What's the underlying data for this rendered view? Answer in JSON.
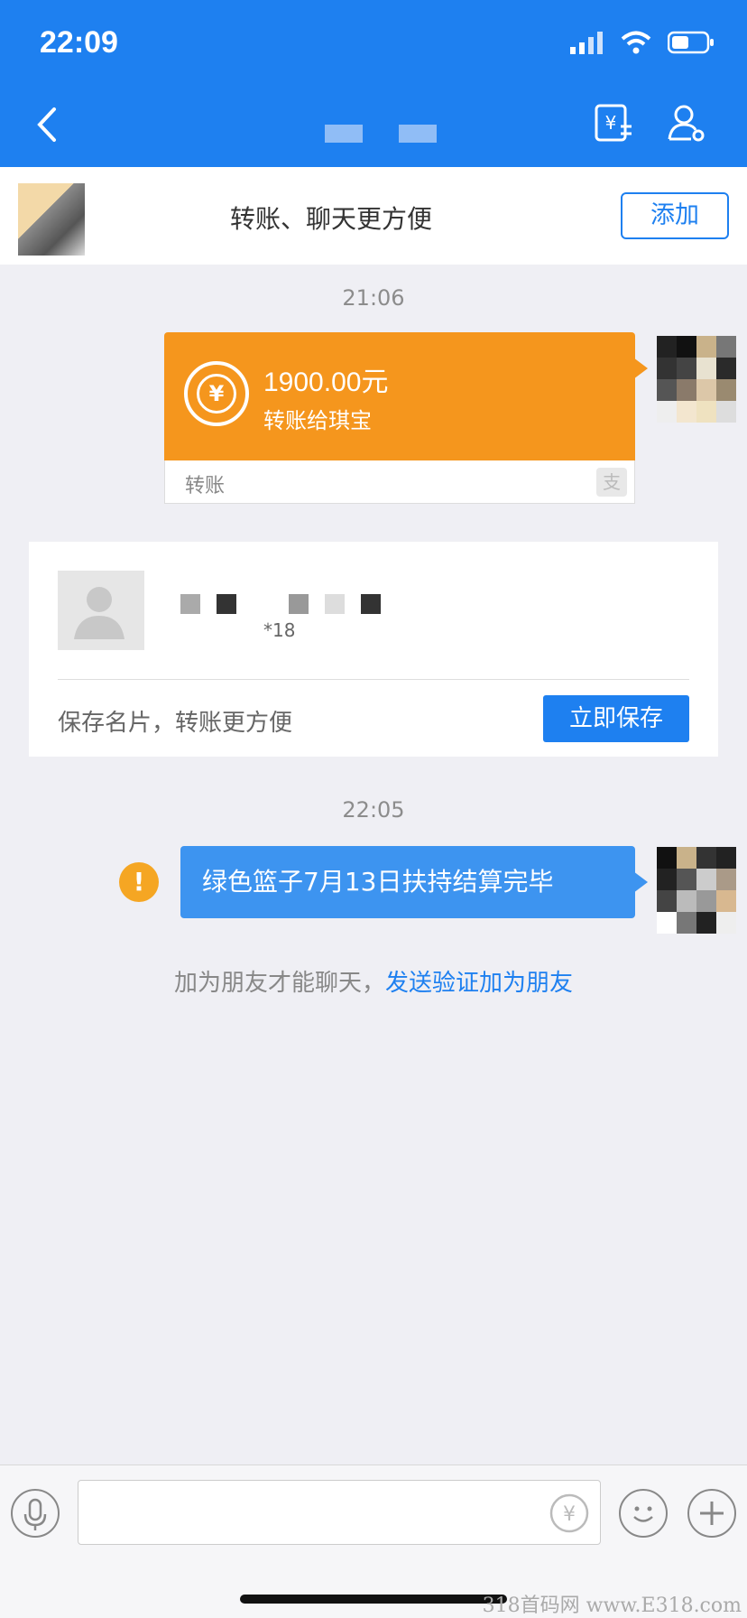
{
  "status_bar": {
    "time": "22:09"
  },
  "banner": {
    "text": "转账、聊天更方便",
    "add_label": "添加"
  },
  "chat": {
    "time1": "21:06",
    "transfer": {
      "amount": "1900.00元",
      "desc": "转账给琪宝",
      "label": "转账",
      "alipay_glyph": "支"
    },
    "card": {
      "sub_text": "*18",
      "hint": "保存名片，转账更方便",
      "save_label": "立即保存"
    },
    "time2": "22:05",
    "message": "绿色篮子7月13日扶持结算完毕",
    "warn_glyph": "!",
    "friend_hint": "加为朋友才能聊天，",
    "friend_link": "发送验证加为朋友"
  },
  "watermark": "318首码网 www.E318.com",
  "colors": {
    "brand": "#1e80f0",
    "transfer": "#f5961d",
    "bubble": "#3d94f0",
    "warning": "#f5a623"
  }
}
